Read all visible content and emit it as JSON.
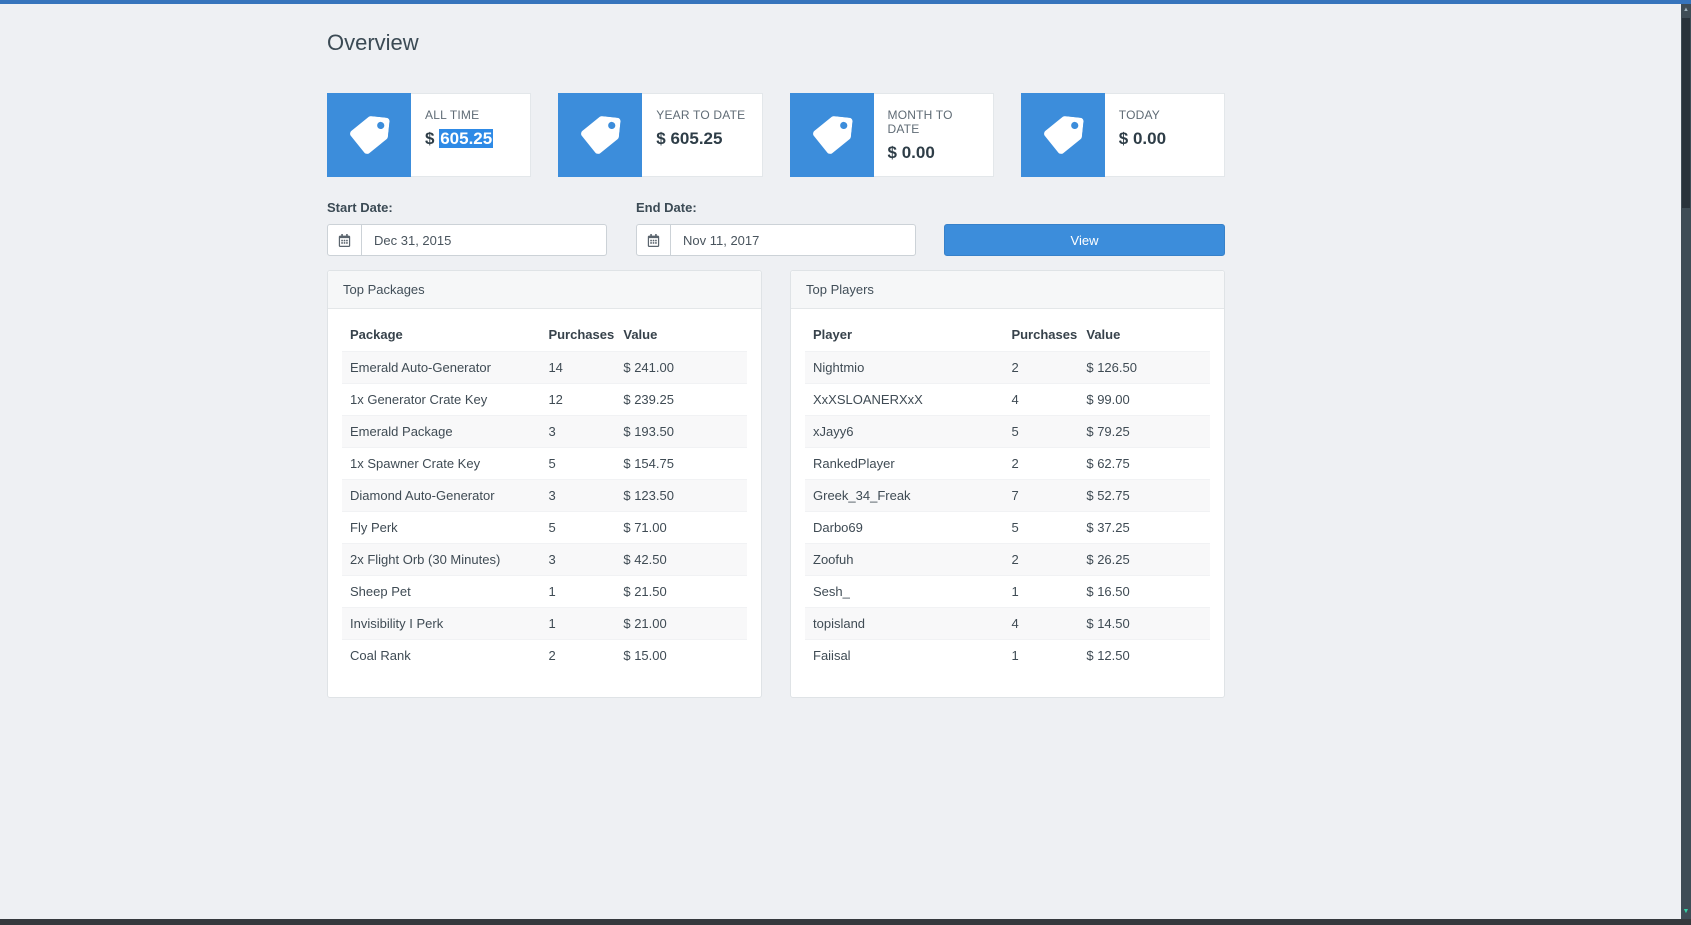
{
  "page": {
    "title": "Overview"
  },
  "theme": {
    "accent": "#3c8ddb",
    "top_bar": "#3674bc",
    "selection": "#2e8ae6",
    "background": "#eef0f3"
  },
  "icons": {
    "stat_card": "tag",
    "date_picker": "calendar",
    "scrollbar_up": "▲",
    "scrollbar_down": "▼"
  },
  "stats": [
    {
      "label": "ALL TIME",
      "prefix": "$",
      "amount": "605.25",
      "selected": true
    },
    {
      "label": "YEAR TO DATE",
      "prefix": "$",
      "amount": "605.25",
      "selected": false
    },
    {
      "label": "MONTH TO DATE",
      "prefix": "$",
      "amount": "0.00",
      "selected": false
    },
    {
      "label": "TODAY",
      "prefix": "$",
      "amount": "0.00",
      "selected": false
    }
  ],
  "filters": {
    "start_label": "Start Date:",
    "start_value": "Dec 31, 2015",
    "end_label": "End Date:",
    "end_value": "Nov 11, 2017",
    "view_button": "View"
  },
  "top_packages": {
    "title": "Top Packages",
    "columns": [
      "Package",
      "Purchases",
      "Value"
    ],
    "rows": [
      [
        "Emerald Auto-Generator",
        "14",
        "$ 241.00"
      ],
      [
        "1x Generator Crate Key",
        "12",
        "$ 239.25"
      ],
      [
        "Emerald Package",
        "3",
        "$ 193.50"
      ],
      [
        "1x Spawner Crate Key",
        "5",
        "$ 154.75"
      ],
      [
        "Diamond Auto-Generator",
        "3",
        "$ 123.50"
      ],
      [
        "Fly Perk",
        "5",
        "$ 71.00"
      ],
      [
        "2x Flight Orb (30 Minutes)",
        "3",
        "$ 42.50"
      ],
      [
        "Sheep Pet",
        "1",
        "$ 21.50"
      ],
      [
        "Invisibility I Perk",
        "1",
        "$ 21.00"
      ],
      [
        "Coal Rank",
        "2",
        "$ 15.00"
      ]
    ]
  },
  "top_players": {
    "title": "Top Players",
    "columns": [
      "Player",
      "Purchases",
      "Value"
    ],
    "rows": [
      [
        "Nightmio",
        "2",
        "$ 126.50"
      ],
      [
        "XxXSLOANERXxX",
        "4",
        "$ 99.00"
      ],
      [
        "xJayy6",
        "5",
        "$ 79.25"
      ],
      [
        "RankedPlayer",
        "2",
        "$ 62.75"
      ],
      [
        "Greek_34_Freak",
        "7",
        "$ 52.75"
      ],
      [
        "Darbo69",
        "5",
        "$ 37.25"
      ],
      [
        "Zoofuh",
        "2",
        "$ 26.25"
      ],
      [
        "Sesh_",
        "1",
        "$ 16.50"
      ],
      [
        "topisland",
        "4",
        "$ 14.50"
      ],
      [
        "Faiisal",
        "1",
        "$ 12.50"
      ]
    ]
  }
}
